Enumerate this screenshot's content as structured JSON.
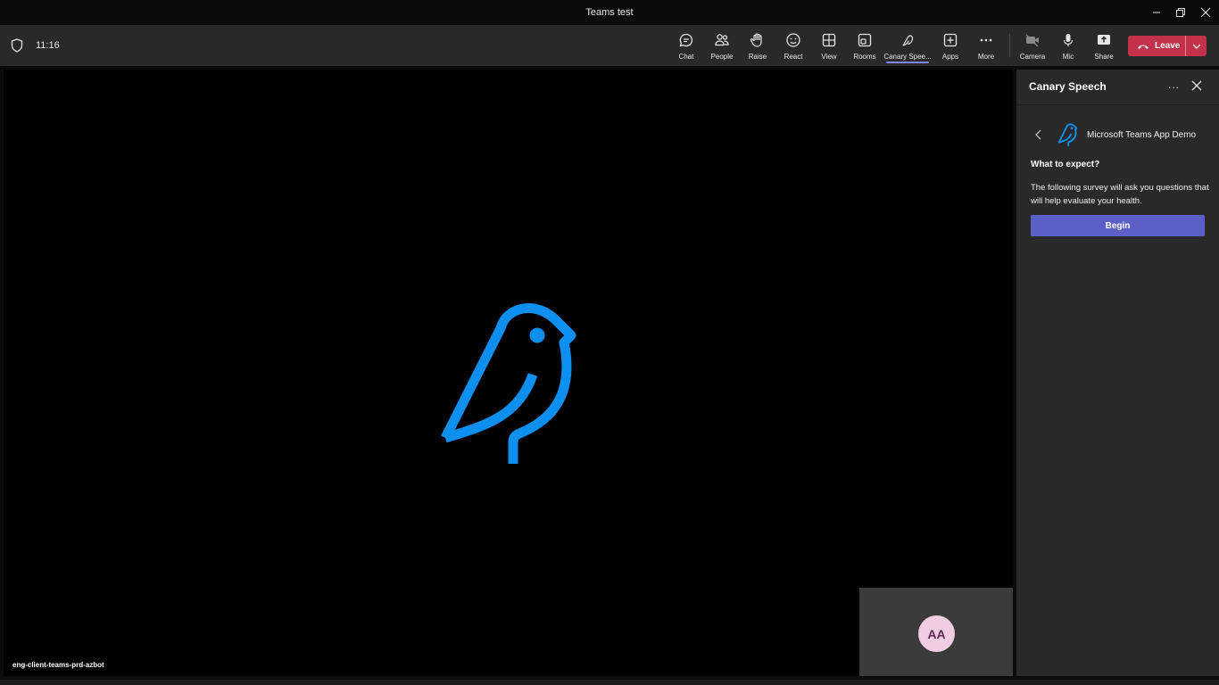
{
  "window": {
    "title": "Teams test"
  },
  "meeting": {
    "timer": "11:16"
  },
  "toolbar": {
    "chat": "Chat",
    "people": "People",
    "raise": "Raise",
    "react": "React",
    "view": "View",
    "rooms": "Rooms",
    "canary": "Canary Spee...",
    "apps": "Apps",
    "more": "More",
    "camera": "Camera",
    "mic": "Mic",
    "share": "Share",
    "leave": "Leave"
  },
  "stage": {
    "participant": "eng-client-teams-prd-azbot",
    "self_initials": "AA",
    "bird_color": "#0d8ff0"
  },
  "panel": {
    "title": "Canary Speech",
    "more": "...",
    "app_name": "Microsoft Teams App Demo",
    "heading": "What to expect?",
    "description": "The following survey will ask you questions that will help evaluate your health.",
    "begin": "Begin"
  },
  "colors": {
    "leave": "#c4314b",
    "accent": "#5b5fc7",
    "active_underline": "#7f85f5"
  }
}
